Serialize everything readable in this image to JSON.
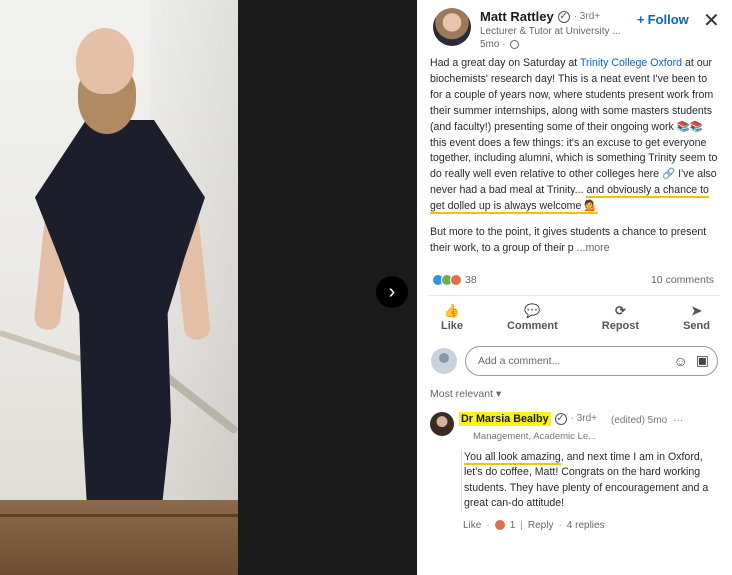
{
  "author": {
    "name": "Matt Rattley",
    "degree": "· 3rd+",
    "headline": "Lecturer & Tutor at University ...",
    "time": "5mo ·"
  },
  "follow_label": "Follow",
  "follow_icon": "+",
  "close_icon": "✕",
  "next_icon": "›",
  "post": {
    "p1_a": "Had a great day on Saturday at ",
    "p1_link": "Trinity College Oxford",
    "p1_b": " at our biochemists' research day! This is a neat event I've been to for a couple of years now, where students present work from their summer internships, along with some masters students (and faculty!) presenting some of their ongoing work 📚📚 this event does a few things: it's an excuse to get everyone together, including alumni, which is something Trinity seem to do really well even relative to other colleges here 🔗 I've also never had a bad meal at Trinity... ",
    "p1_hl": "and obviously a chance to get dolled up is always welcome",
    "p1_emoji": "💁",
    "p2": "But more to the point, it gives students a chance to present their work, to a group of their p",
    "more": "...more"
  },
  "reactions": {
    "count": "38",
    "comments": "10 comments"
  },
  "actions": [
    {
      "label": "Like",
      "icon": "👍"
    },
    {
      "label": "Comment",
      "icon": "💬"
    },
    {
      "label": "Repost",
      "icon": "⟳"
    },
    {
      "label": "Send",
      "icon": "➤"
    }
  ],
  "comment_input": {
    "placeholder": "Add a comment..."
  },
  "sort": "Most relevant ▾",
  "comment": {
    "name": "Dr Marsia Bealby",
    "degree": "· 3rd+",
    "edited": "(edited) 5mo",
    "menu": "···",
    "headline": "Management, Academic Le...",
    "body_hl": "You all look amazing",
    "body_rest": ", and next time I am in Oxford, let's do coffee, Matt! Congrats on the hard working students. They have plenty of encouragement and a great can-do attitude!",
    "like": "Like",
    "likes": "1",
    "reply": "Reply",
    "replies": "4 replies"
  }
}
